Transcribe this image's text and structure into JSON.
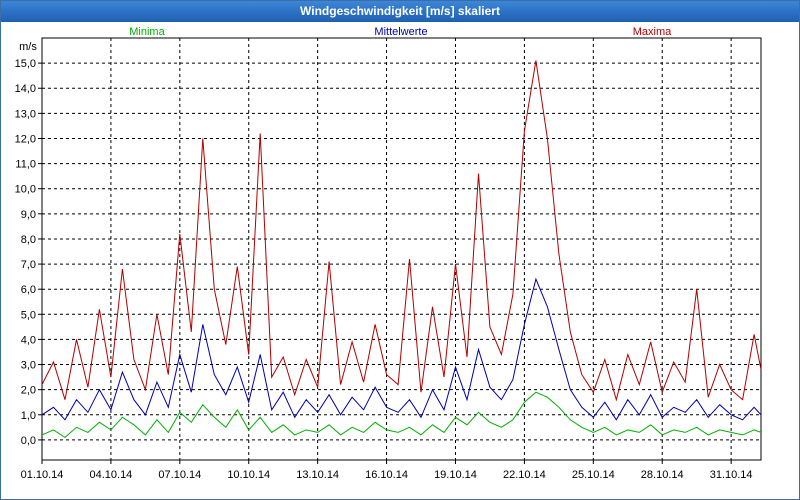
{
  "window": {
    "title": "Windgeschwindigkeit [m/s] skaliert"
  },
  "chart_data": {
    "type": "line",
    "title": "Windgeschwindigkeit [m/s] skaliert",
    "ylabel": "m/s",
    "xlabel": "",
    "ylim": [
      -0.8,
      16.0
    ],
    "xlim": [
      0,
      31.3
    ],
    "grid": true,
    "legend_placement": "top",
    "y_ticks": [
      "0,0",
      "1,0",
      "2,0",
      "3,0",
      "4,0",
      "5,0",
      "6,0",
      "7,0",
      "8,0",
      "9,0",
      "10,0",
      "11,0",
      "12,0",
      "13,0",
      "14,0",
      "15,0"
    ],
    "y_tick_values": [
      0,
      1,
      2,
      3,
      4,
      5,
      6,
      7,
      8,
      9,
      10,
      11,
      12,
      13,
      14,
      15
    ],
    "x_ticks": [
      "01.10.14",
      "04.10.14",
      "07.10.14",
      "10.10.14",
      "13.10.14",
      "16.10.14",
      "19.10.14",
      "22.10.14",
      "25.10.14",
      "28.10.14",
      "31.10.14"
    ],
    "x_tick_values": [
      0,
      3,
      6,
      9,
      12,
      15,
      18,
      21,
      24,
      27,
      30
    ],
    "series": [
      {
        "name": "Minima",
        "color": "#00b000",
        "x": [
          0.0,
          0.5,
          1.0,
          1.5,
          2.0,
          2.5,
          3.0,
          3.5,
          4.0,
          4.5,
          5.0,
          5.5,
          6.0,
          6.5,
          7.0,
          7.5,
          8.0,
          8.5,
          9.0,
          9.5,
          10.0,
          10.5,
          11.0,
          11.5,
          12.0,
          12.5,
          13.0,
          13.5,
          14.0,
          14.5,
          15.0,
          15.5,
          16.0,
          16.5,
          17.0,
          17.5,
          18.0,
          18.5,
          19.0,
          19.5,
          20.0,
          20.5,
          21.0,
          21.5,
          22.0,
          22.5,
          23.0,
          23.5,
          24.0,
          24.5,
          25.0,
          25.5,
          26.0,
          26.5,
          27.0,
          27.5,
          28.0,
          28.5,
          29.0,
          29.5,
          30.0,
          30.5,
          31.0,
          31.3
        ],
        "y": [
          0.2,
          0.4,
          0.1,
          0.5,
          0.3,
          0.7,
          0.4,
          0.9,
          0.6,
          0.2,
          0.8,
          0.3,
          1.1,
          0.7,
          1.4,
          0.9,
          0.5,
          1.2,
          0.4,
          0.9,
          0.3,
          0.6,
          0.2,
          0.4,
          0.3,
          0.6,
          0.2,
          0.5,
          0.3,
          0.7,
          0.4,
          0.3,
          0.5,
          0.2,
          0.6,
          0.3,
          0.9,
          0.6,
          1.1,
          0.7,
          0.5,
          0.8,
          1.5,
          1.9,
          1.7,
          1.3,
          0.8,
          0.5,
          0.3,
          0.5,
          0.2,
          0.4,
          0.3,
          0.6,
          0.2,
          0.4,
          0.3,
          0.5,
          0.2,
          0.4,
          0.3,
          0.2,
          0.4,
          0.3
        ]
      },
      {
        "name": "Mittelwerte",
        "color": "#0000b0",
        "x": [
          0.0,
          0.5,
          1.0,
          1.5,
          2.0,
          2.5,
          3.0,
          3.5,
          4.0,
          4.5,
          5.0,
          5.5,
          6.0,
          6.5,
          7.0,
          7.5,
          8.0,
          8.5,
          9.0,
          9.5,
          10.0,
          10.5,
          11.0,
          11.5,
          12.0,
          12.5,
          13.0,
          13.5,
          14.0,
          14.5,
          15.0,
          15.5,
          16.0,
          16.5,
          17.0,
          17.5,
          18.0,
          18.5,
          19.0,
          19.5,
          20.0,
          20.5,
          21.0,
          21.5,
          22.0,
          22.5,
          23.0,
          23.5,
          24.0,
          24.5,
          25.0,
          25.5,
          26.0,
          26.5,
          27.0,
          27.5,
          28.0,
          28.5,
          29.0,
          29.5,
          30.0,
          30.5,
          31.0,
          31.3
        ],
        "y": [
          1.0,
          1.3,
          0.8,
          1.6,
          1.1,
          2.0,
          1.2,
          2.7,
          1.6,
          1.0,
          2.3,
          1.3,
          3.4,
          1.9,
          4.6,
          2.6,
          1.8,
          2.9,
          1.5,
          3.4,
          1.2,
          1.9,
          0.9,
          1.6,
          1.1,
          1.8,
          1.0,
          1.7,
          1.2,
          2.1,
          1.3,
          1.1,
          1.6,
          0.9,
          2.0,
          1.2,
          2.9,
          1.6,
          3.6,
          2.1,
          1.6,
          2.4,
          4.6,
          6.4,
          5.3,
          3.6,
          2.0,
          1.3,
          0.9,
          1.5,
          0.8,
          1.6,
          1.0,
          1.8,
          0.9,
          1.3,
          1.1,
          1.6,
          0.9,
          1.4,
          1.0,
          0.8,
          1.3,
          1.0
        ]
      },
      {
        "name": "Maxima",
        "color": "#b00000",
        "x": [
          0.0,
          0.5,
          1.0,
          1.5,
          2.0,
          2.5,
          3.0,
          3.5,
          4.0,
          4.5,
          5.0,
          5.5,
          6.0,
          6.5,
          7.0,
          7.5,
          8.0,
          8.5,
          9.0,
          9.5,
          10.0,
          10.5,
          11.0,
          11.5,
          12.0,
          12.5,
          13.0,
          13.5,
          14.0,
          14.5,
          15.0,
          15.5,
          16.0,
          16.5,
          17.0,
          17.5,
          18.0,
          18.5,
          19.0,
          19.5,
          20.0,
          20.5,
          21.0,
          21.5,
          22.0,
          22.5,
          23.0,
          23.5,
          24.0,
          24.5,
          25.0,
          25.5,
          26.0,
          26.5,
          27.0,
          27.5,
          28.0,
          28.5,
          29.0,
          29.5,
          30.0,
          30.5,
          31.0,
          31.3
        ],
        "y": [
          2.2,
          3.1,
          1.6,
          4.0,
          2.1,
          5.2,
          2.5,
          6.8,
          3.2,
          2.0,
          5.0,
          2.6,
          8.2,
          4.3,
          12.0,
          6.0,
          3.8,
          6.9,
          3.4,
          12.2,
          2.5,
          3.3,
          1.8,
          3.2,
          2.1,
          7.1,
          2.2,
          3.9,
          2.3,
          4.6,
          2.6,
          2.2,
          7.2,
          1.9,
          5.3,
          2.5,
          7.0,
          3.3,
          10.6,
          4.5,
          3.4,
          5.8,
          12.3,
          15.1,
          12.0,
          7.4,
          4.3,
          2.6,
          1.9,
          3.2,
          1.6,
          3.4,
          2.2,
          3.9,
          1.9,
          3.1,
          2.3,
          6.0,
          1.7,
          3.0,
          2.0,
          1.6,
          4.2,
          2.8
        ]
      }
    ]
  }
}
